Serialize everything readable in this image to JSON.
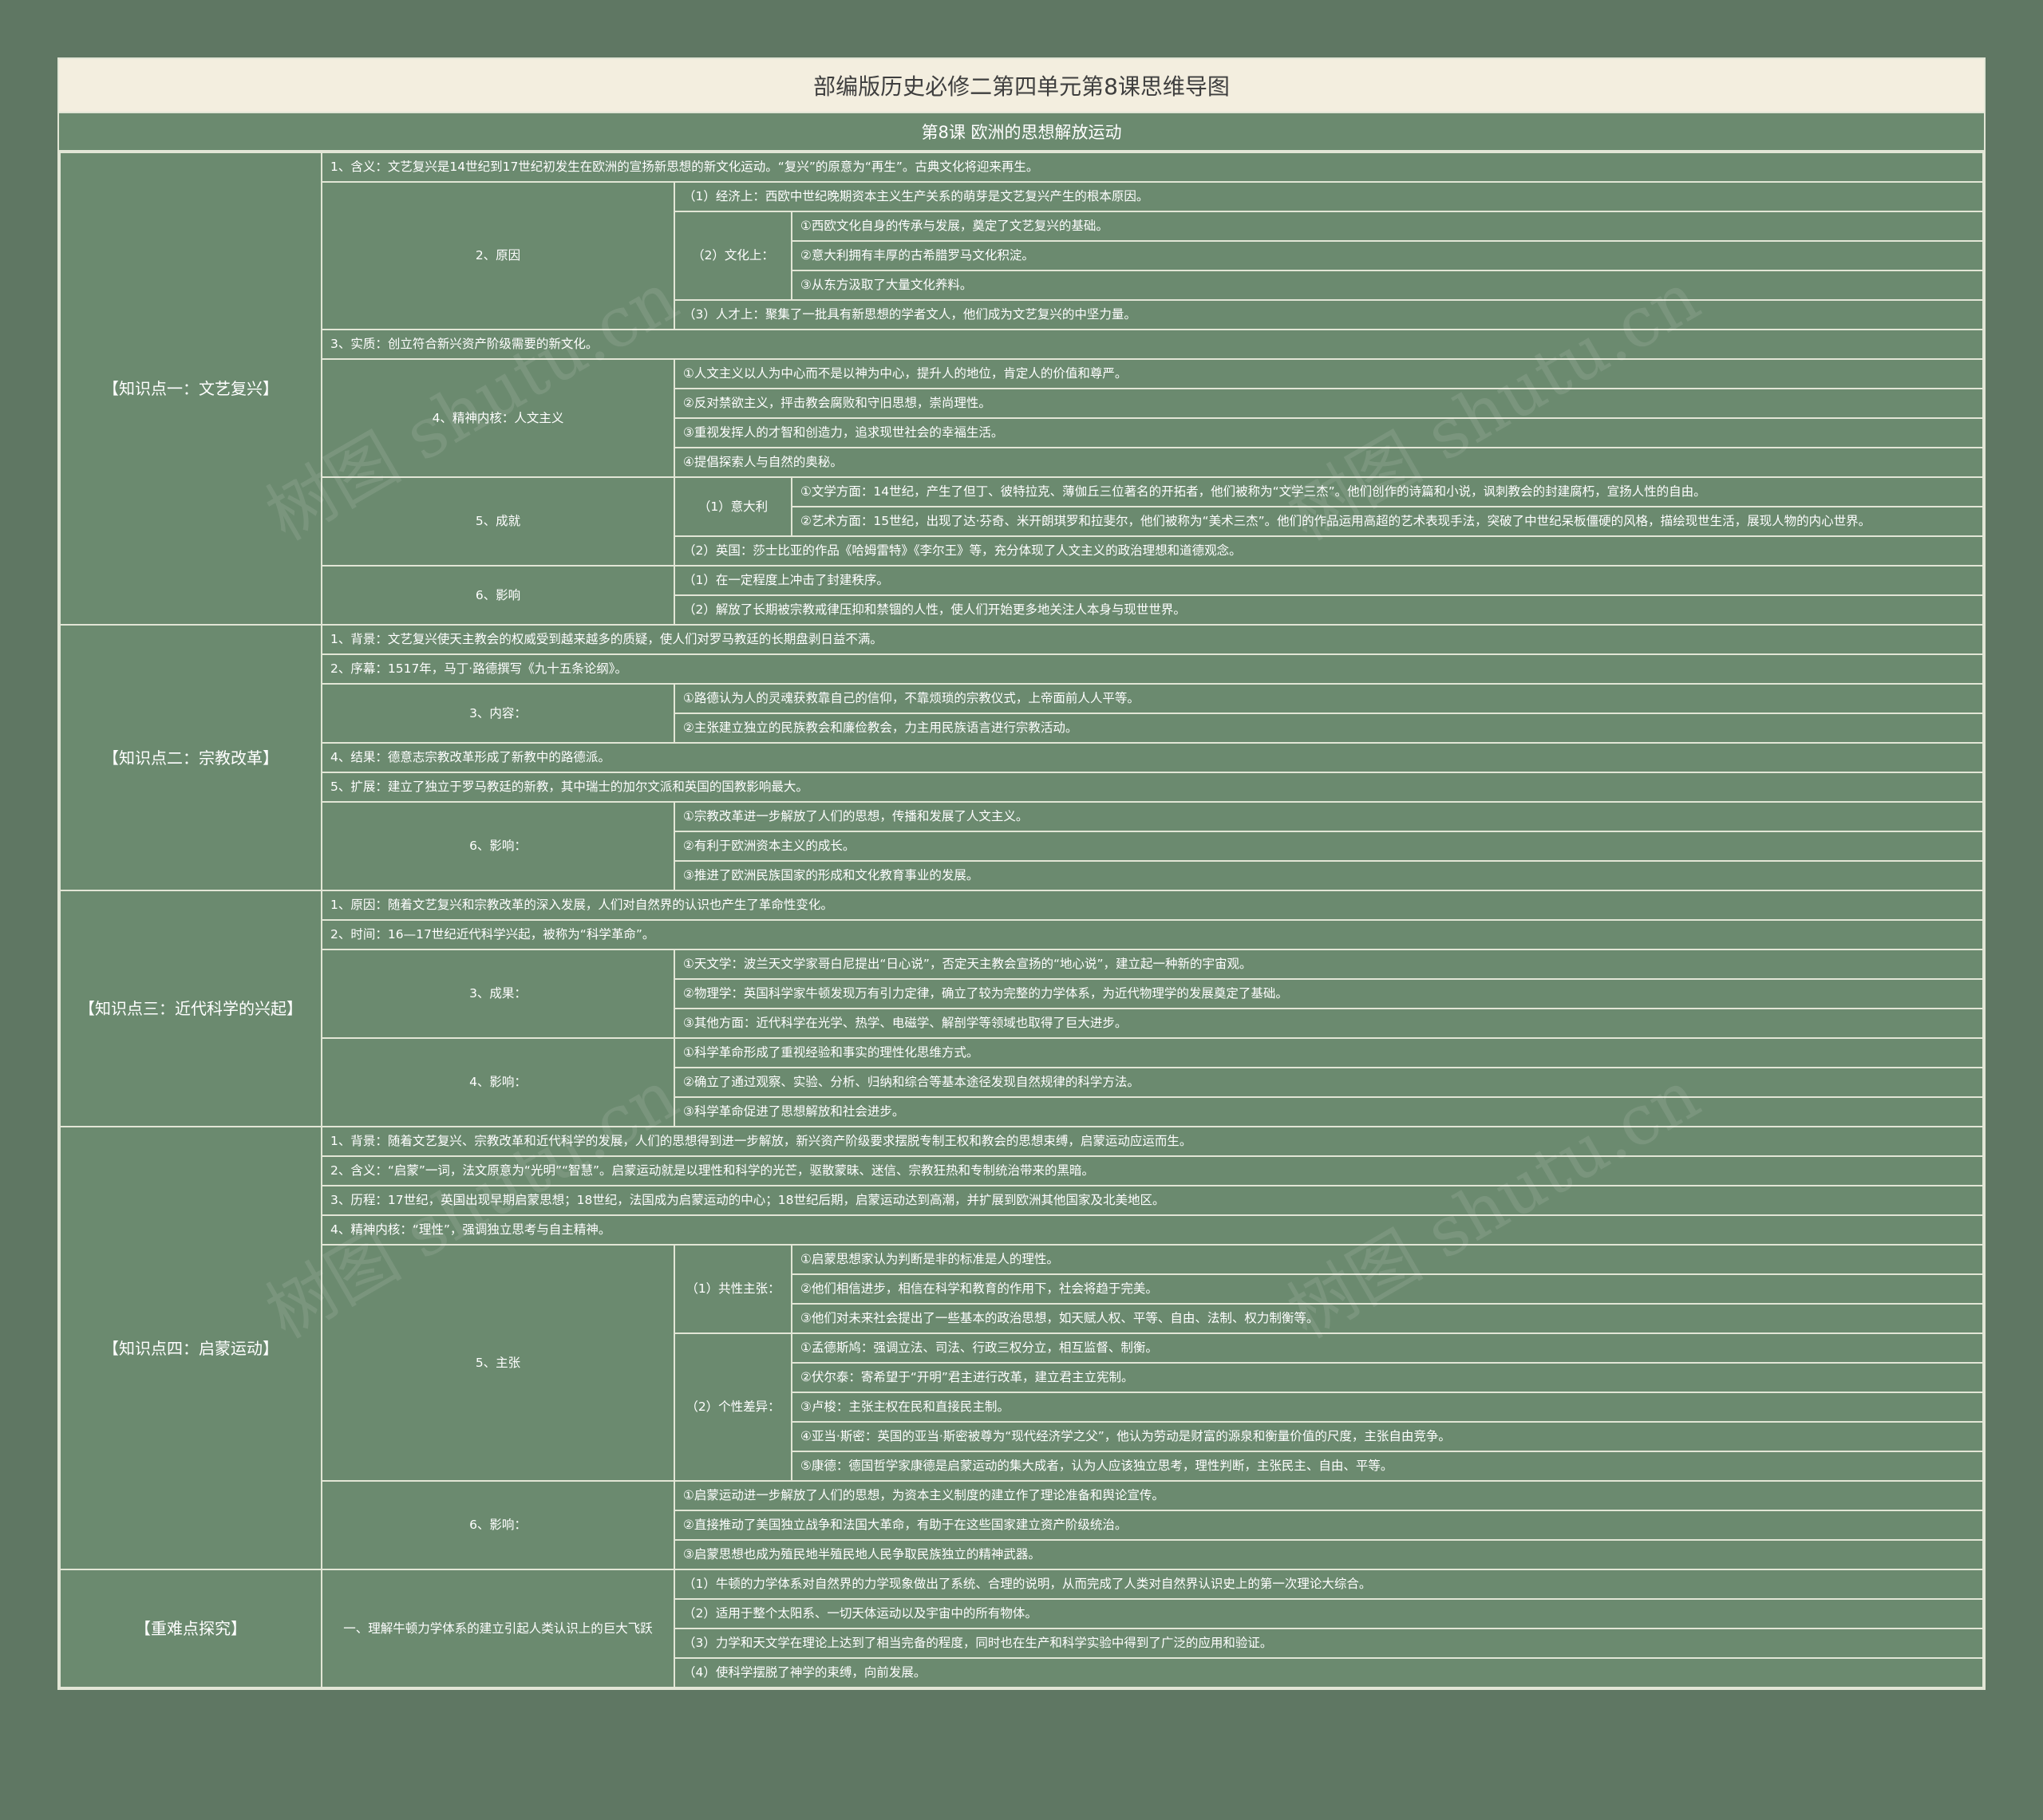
{
  "title": "部编版历史必修二第四单元第8课思维导图",
  "subtitle": "第8课  欧洲的思想解放运动",
  "watermark": "树图 shutu.cn",
  "colors": {
    "background": "#5f7763",
    "cell": "#6b8a6f",
    "title_bar": "#f3eedf",
    "border": "#e2e6d6"
  },
  "sections": [
    {
      "label": "【知识点一：文艺复兴】",
      "items": [
        {
          "text": "1、含义：文艺复兴是14世纪到17世纪初发生在欧洲的宣扬新思想的新文化运动。“复兴”的原意为“再生”。古典文化将迎来再生。"
        },
        {
          "label": "2、原因",
          "children": [
            {
              "text": "（1）经济上：西欧中世纪晚期资本主义生产关系的萌芽是文艺复兴产生的根本原因。"
            },
            {
              "label": "（2）文化上：",
              "children": [
                {
                  "text": "①西欧文化自身的传承与发展，奠定了文艺复兴的基础。"
                },
                {
                  "text": "②意大利拥有丰厚的古希腊罗马文化积淀。"
                },
                {
                  "text": "③从东方汲取了大量文化养料。"
                }
              ]
            },
            {
              "text": "（3）人才上：聚集了一批具有新思想的学者文人，他们成为文艺复兴的中坚力量。"
            }
          ]
        },
        {
          "text": "3、实质：创立符合新兴资产阶级需要的新文化。"
        },
        {
          "label": "4、精神内核：人文主义",
          "children": [
            {
              "text": "①人文主义以人为中心而不是以神为中心，提升人的地位，肯定人的价值和尊严。"
            },
            {
              "text": "②反对禁欲主义，抨击教会腐败和守旧思想，崇尚理性。"
            },
            {
              "text": "③重视发挥人的才智和创造力，追求现世社会的幸福生活。"
            },
            {
              "text": "④提倡探索人与自然的奥秘。"
            }
          ]
        },
        {
          "label": "5、成就",
          "children": [
            {
              "label": "（1）意大利",
              "children": [
                {
                  "text": "①文学方面：14世纪，产生了但丁、彼特拉克、薄伽丘三位著名的开拓者，他们被称为“文学三杰”。他们创作的诗篇和小说，讽刺教会的封建腐朽，宣扬人性的自由。"
                },
                {
                  "text": "②艺术方面：15世纪，出现了达·芬奇、米开朗琪罗和拉斐尔，他们被称为“美术三杰”。他们的作品运用高超的艺术表现手法，突破了中世纪呆板僵硬的风格，描绘现世生活，展现人物的内心世界。"
                }
              ]
            },
            {
              "text": "（2）英国：莎士比亚的作品《哈姆雷特》《李尔王》等，充分体现了人文主义的政治理想和道德观念。"
            }
          ]
        },
        {
          "label": "6、影响",
          "children": [
            {
              "text": "（1）在一定程度上冲击了封建秩序。"
            },
            {
              "text": "（2）解放了长期被宗教戒律压抑和禁锢的人性，使人们开始更多地关注人本身与现世世界。"
            }
          ]
        }
      ]
    },
    {
      "label": "【知识点二：宗教改革】",
      "items": [
        {
          "text": "1、背景：文艺复兴使天主教会的权威受到越来越多的质疑，使人们对罗马教廷的长期盘剥日益不满。"
        },
        {
          "text": "2、序幕：1517年，马丁·路德撰写《九十五条论纲》。"
        },
        {
          "label": "3、内容：",
          "children": [
            {
              "text": "①路德认为人的灵魂获救靠自己的信仰，不靠烦琐的宗教仪式，上帝面前人人平等。"
            },
            {
              "text": "②主张建立独立的民族教会和廉俭教会，力主用民族语言进行宗教活动。"
            }
          ]
        },
        {
          "text": "4、结果：德意志宗教改革形成了新教中的路德派。"
        },
        {
          "text": "5、扩展：建立了独立于罗马教廷的新教，其中瑞士的加尔文派和英国的国教影响最大。"
        },
        {
          "label": "6、影响：",
          "children": [
            {
              "text": "①宗教改革进一步解放了人们的思想，传播和发展了人文主义。"
            },
            {
              "text": "②有利于欧洲资本主义的成长。"
            },
            {
              "text": "③推进了欧洲民族国家的形成和文化教育事业的发展。"
            }
          ]
        }
      ]
    },
    {
      "label": "【知识点三：近代科学的兴起】",
      "items": [
        {
          "text": "1、原因：随着文艺复兴和宗教改革的深入发展，人们对自然界的认识也产生了革命性变化。"
        },
        {
          "text": "2、时间：16—17世纪近代科学兴起，被称为“科学革命”。"
        },
        {
          "label": "3、成果：",
          "children": [
            {
              "text": "①天文学：波兰天文学家哥白尼提出“日心说”，否定天主教会宣扬的“地心说”，建立起一种新的宇宙观。"
            },
            {
              "text": "②物理学：英国科学家牛顿发现万有引力定律，确立了较为完整的力学体系，为近代物理学的发展奠定了基础。"
            },
            {
              "text": "③其他方面：近代科学在光学、热学、电磁学、解剖学等领域也取得了巨大进步。"
            }
          ]
        },
        {
          "label": "4、影响：",
          "children": [
            {
              "text": "①科学革命形成了重视经验和事实的理性化思维方式。"
            },
            {
              "text": "②确立了通过观察、实验、分析、归纳和综合等基本途径发现自然规律的科学方法。"
            },
            {
              "text": "③科学革命促进了思想解放和社会进步。"
            }
          ]
        }
      ]
    },
    {
      "label": "【知识点四：启蒙运动】",
      "items": [
        {
          "text": "1、背景：随着文艺复兴、宗教改革和近代科学的发展，人们的思想得到进一步解放，新兴资产阶级要求摆脱专制王权和教会的思想束缚，启蒙运动应运而生。"
        },
        {
          "text": "2、含义：“启蒙”一词，法文原意为“光明”“智慧”。启蒙运动就是以理性和科学的光芒，驱散蒙昧、迷信、宗教狂热和专制统治带来的黑暗。"
        },
        {
          "text": "3、历程：17世纪，英国出现早期启蒙思想；18世纪，法国成为启蒙运动的中心；18世纪后期，启蒙运动达到高潮，并扩展到欧洲其他国家及北美地区。"
        },
        {
          "text": "4、精神内核：“理性”，强调独立思考与自主精神。"
        },
        {
          "label": "5、主张",
          "children": [
            {
              "label": "（1）共性主张：",
              "children": [
                {
                  "text": "①启蒙思想家认为判断是非的标准是人的理性。"
                },
                {
                  "text": "②他们相信进步，相信在科学和教育的作用下，社会将趋于完美。"
                },
                {
                  "text": "③他们对未来社会提出了一些基本的政治思想，如天赋人权、平等、自由、法制、权力制衡等。"
                }
              ]
            },
            {
              "label": "（2）个性差异：",
              "children": [
                {
                  "text": "①孟德斯鸠：强调立法、司法、行政三权分立，相互监督、制衡。"
                },
                {
                  "text": "②伏尔泰：寄希望于“开明”君主进行改革，建立君主立宪制。"
                },
                {
                  "text": "③卢梭：主张主权在民和直接民主制。"
                },
                {
                  "text": "④亚当·斯密：英国的亚当·斯密被尊为“现代经济学之父”，他认为劳动是财富的源泉和衡量价值的尺度，主张自由竞争。"
                },
                {
                  "text": "⑤康德：德国哲学家康德是启蒙运动的集大成者，认为人应该独立思考，理性判断，主张民主、自由、平等。"
                }
              ]
            }
          ]
        },
        {
          "label": "6、影响：",
          "children": [
            {
              "text": "①启蒙运动进一步解放了人们的思想，为资本主义制度的建立作了理论准备和舆论宣传。"
            },
            {
              "text": "②直接推动了美国独立战争和法国大革命，有助于在这些国家建立资产阶级统治。"
            },
            {
              "text": "③启蒙思想也成为殖民地半殖民地人民争取民族独立的精神武器。"
            }
          ]
        }
      ]
    },
    {
      "label": "【重难点探究】",
      "items": [
        {
          "label": "一、理解牛顿力学体系的建立引起人类认识上的巨大飞跃",
          "children": [
            {
              "text": "（1）牛顿的力学体系对自然界的力学现象做出了系统、合理的说明，从而完成了人类对自然界认识史上的第一次理论大综合。"
            },
            {
              "text": "（2）适用于整个太阳系、一切天体运动以及宇宙中的所有物体。"
            },
            {
              "text": "（3）力学和天文学在理论上达到了相当完备的程度，同时也在生产和科学实验中得到了广泛的应用和验证。"
            },
            {
              "text": "（4）使科学摆脱了神学的束缚，向前发展。"
            }
          ]
        }
      ]
    }
  ]
}
